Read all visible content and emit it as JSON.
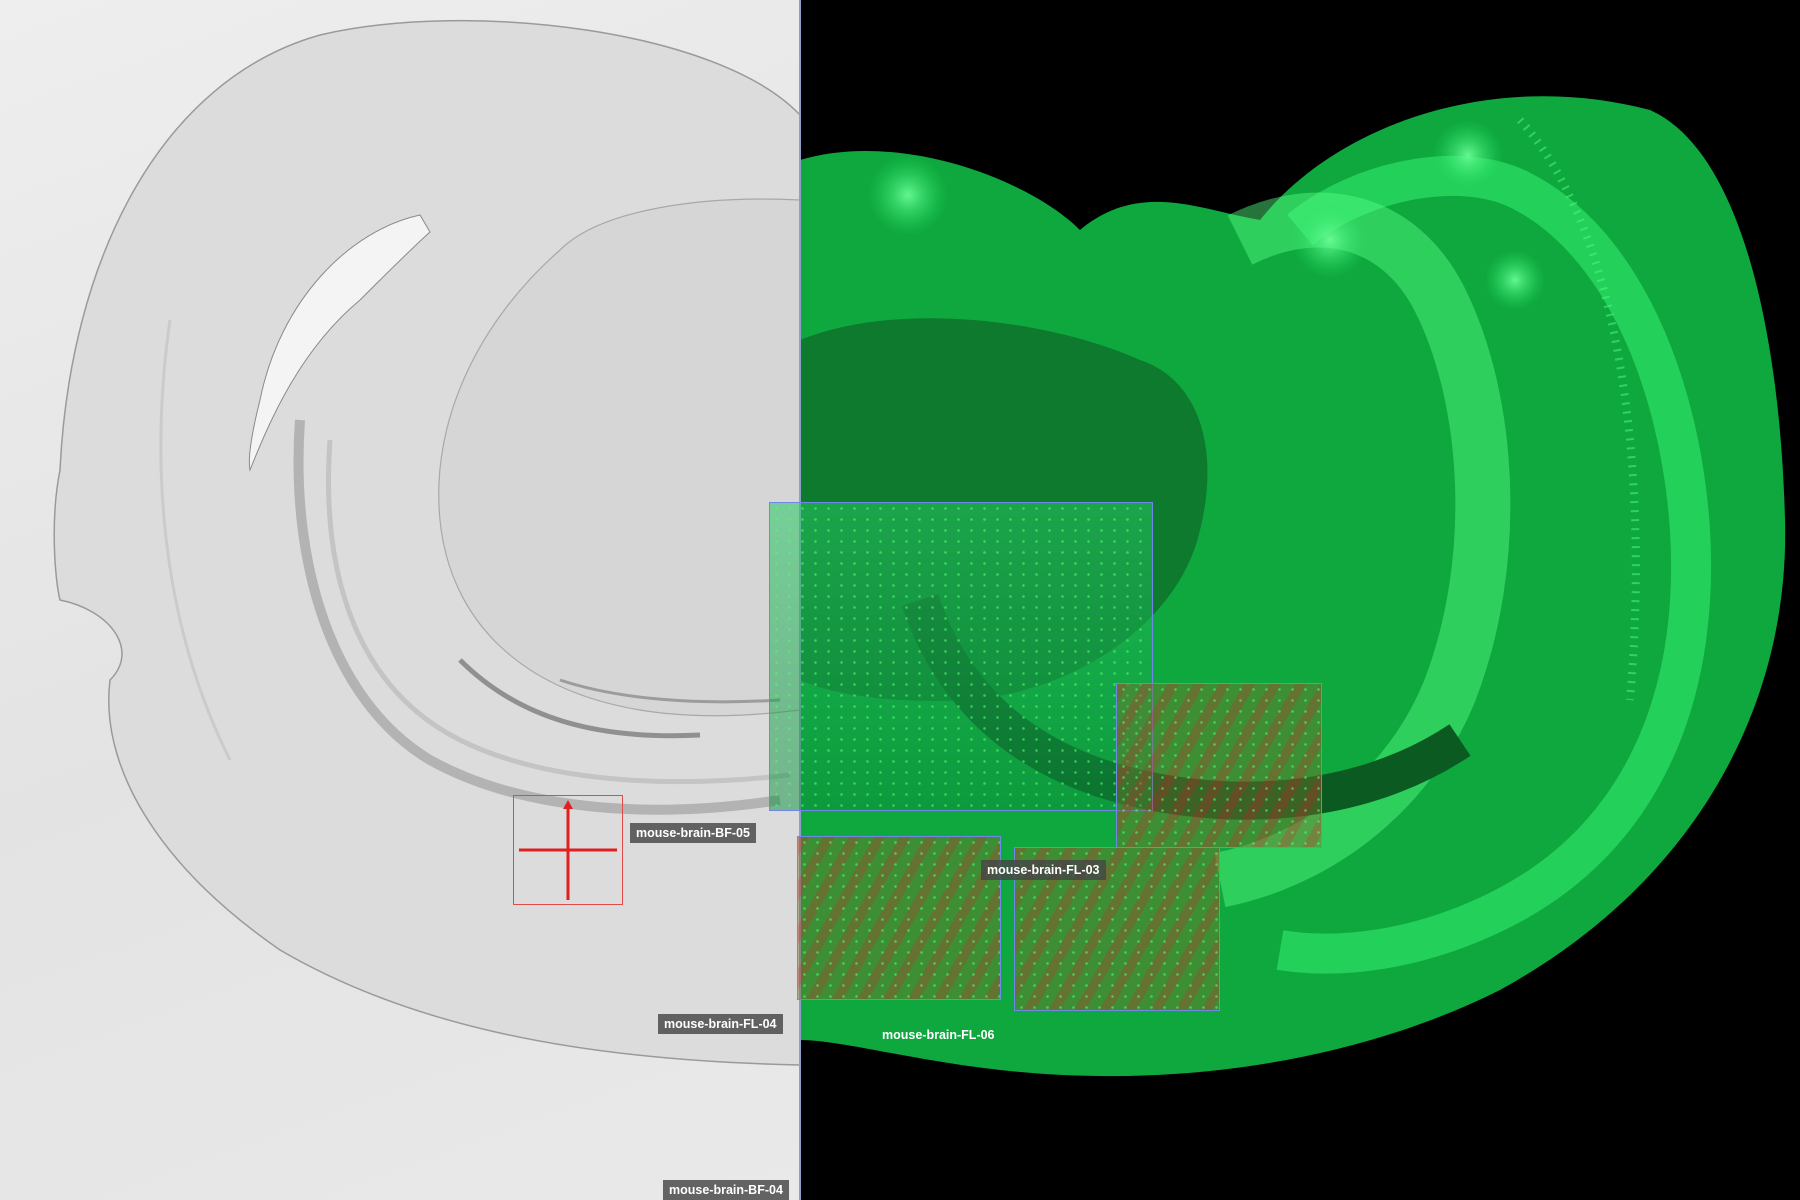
{
  "viewer": {
    "panes": [
      {
        "channel": "brightfield"
      },
      {
        "channel": "fluorescence"
      }
    ],
    "sample_labels": [
      {
        "id": "bf-05",
        "text": "mouse-brain-BF-05"
      },
      {
        "id": "fl-03",
        "text": "mouse-brain-FL-03"
      },
      {
        "id": "fl-04",
        "text": "mouse-brain-FL-04"
      },
      {
        "id": "fl-06",
        "text": "mouse-brain-FL-06"
      },
      {
        "id": "bf-04",
        "text": "mouse-brain-BF-04"
      }
    ],
    "crosshair": {
      "icon": "crosshair-icon"
    },
    "colors": {
      "brightfield_bg": "#e8e8e8",
      "fluorescence_green": "#22e060",
      "tile_border": "#6f87e8",
      "crosshair_red": "#e02020",
      "label_bg": "#464646"
    }
  }
}
